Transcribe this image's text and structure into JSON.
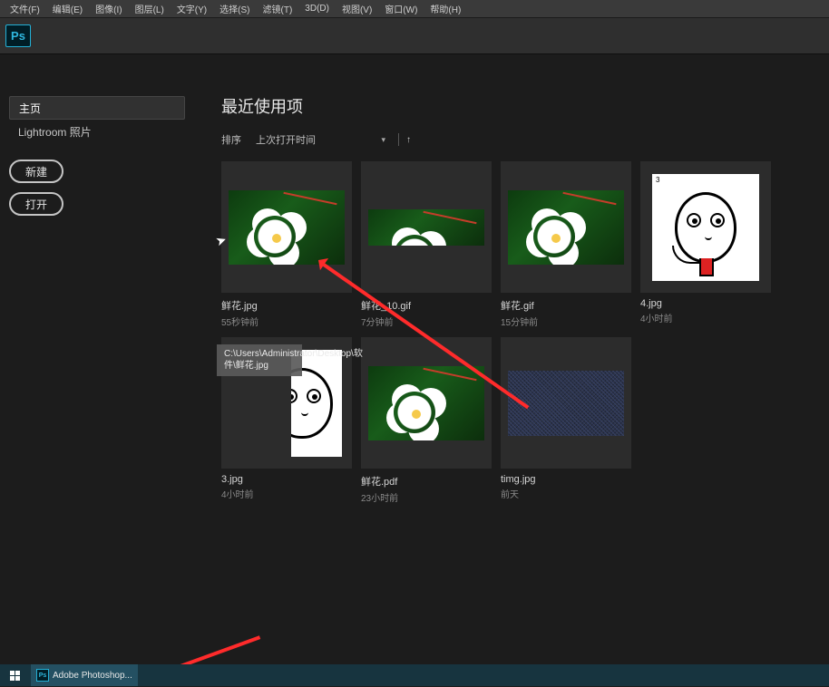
{
  "menu": [
    "文件(F)",
    "编辑(E)",
    "图像(I)",
    "图层(L)",
    "文字(Y)",
    "选择(S)",
    "滤镜(T)",
    "3D(D)",
    "视图(V)",
    "窗口(W)",
    "帮助(H)"
  ],
  "app_badge": "Ps",
  "sidebar": {
    "nav": [
      {
        "label": "主页",
        "active": true
      },
      {
        "label": "Lightroom 照片",
        "active": false
      }
    ],
    "buttons": {
      "new": "新建",
      "open": "打开"
    }
  },
  "content": {
    "title": "最近使用项",
    "sort_label": "排序",
    "sort_value": "上次打开时间",
    "tooltip": "C:\\Users\\Administrator\\Desktop\\软件\\鲜花.jpg"
  },
  "files": [
    {
      "name": "鲜花.jpg",
      "time": "55秒钟前",
      "kind": "flower"
    },
    {
      "name": "鲜花_10.gif",
      "time": "7分钟前",
      "kind": "flower-wide"
    },
    {
      "name": "鲜花.gif",
      "time": "15分钟前",
      "kind": "flower"
    },
    {
      "name": "4.jpg",
      "time": "4小时前",
      "kind": "face-drink"
    },
    {
      "name": "3.jpg",
      "time": "4小时前",
      "kind": "face-partial"
    },
    {
      "name": "鲜花.pdf",
      "time": "23小时前",
      "kind": "flower"
    },
    {
      "name": "timg.jpg",
      "time": "前天",
      "kind": "noise"
    }
  ],
  "taskbar": {
    "app": "Adobe Photoshop..."
  }
}
